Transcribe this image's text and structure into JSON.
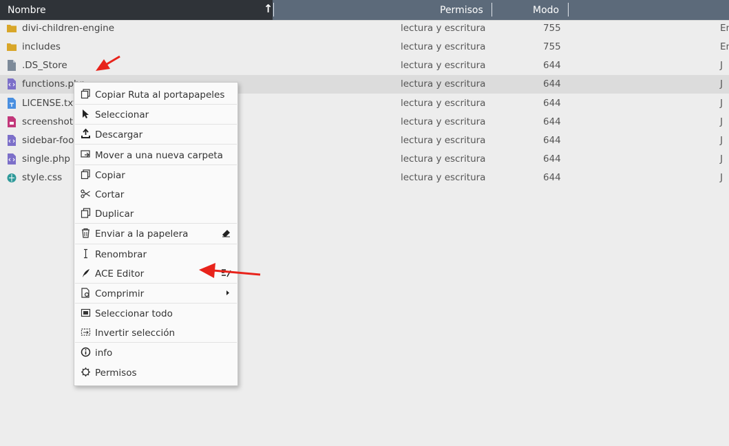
{
  "header": {
    "name_label": "Nombre",
    "permissions_label": "Permisos",
    "mode_label": "Modo",
    "sort_icon": "sort-arrow-up"
  },
  "files": [
    {
      "name": "divi-children-engine",
      "icon": "folder",
      "perm": "lectura y escritura",
      "mode": "755",
      "date": "En",
      "selected": false
    },
    {
      "name": "includes",
      "icon": "folder",
      "perm": "lectura y escritura",
      "mode": "755",
      "date": "En",
      "selected": false
    },
    {
      "name": ".DS_Store",
      "icon": "file-generic",
      "perm": "lectura y escritura",
      "mode": "644",
      "date": "J",
      "selected": false
    },
    {
      "name": "functions.php",
      "icon": "file-php",
      "perm": "lectura y escritura",
      "mode": "644",
      "date": "J",
      "selected": true
    },
    {
      "name": "LICENSE.txt",
      "icon": "file-text",
      "perm": "lectura y escritura",
      "mode": "644",
      "date": "J",
      "selected": false
    },
    {
      "name": "screenshot",
      "icon": "file-image",
      "perm": "lectura y escritura",
      "mode": "644",
      "date": "J",
      "selected": false
    },
    {
      "name": "sidebar-foo",
      "icon": "file-php",
      "perm": "lectura y escritura",
      "mode": "644",
      "date": "J",
      "selected": false
    },
    {
      "name": "single.php",
      "icon": "file-php",
      "perm": "lectura y escritura",
      "mode": "644",
      "date": "J",
      "selected": false
    },
    {
      "name": "style.css",
      "icon": "file-css",
      "perm": "lectura y escritura",
      "mode": "644",
      "date": "J",
      "selected": false
    }
  ],
  "context_menu": {
    "items": [
      {
        "label": "Copiar Ruta al portapapeles",
        "icon": "copy-icon"
      },
      {
        "label": "Seleccionar",
        "icon": "pointer-icon"
      },
      {
        "label": "Descargar",
        "icon": "download-icon"
      },
      {
        "label": "Mover a una nueva carpeta",
        "icon": "move-folder-icon"
      },
      {
        "label": "Copiar",
        "icon": "copy-icon"
      },
      {
        "label": "Cortar",
        "icon": "scissors-icon"
      },
      {
        "label": "Duplicar",
        "icon": "duplicate-icon"
      },
      {
        "label": "Enviar a la papelera",
        "icon": "trash-icon",
        "right_icon": "eraser-icon"
      },
      {
        "label": "Renombrar",
        "icon": "text-cursor-icon"
      },
      {
        "label": "ACE Editor",
        "icon": "quill-icon",
        "right_icon": "editor-icon"
      },
      {
        "label": "Comprimir",
        "icon": "archive-icon",
        "right_icon": "submenu-arrow-icon"
      },
      {
        "label": "Seleccionar todo",
        "icon": "select-all-icon"
      },
      {
        "label": "Invertir selección",
        "icon": "invert-selection-icon"
      },
      {
        "label": "info",
        "icon": "info-icon"
      },
      {
        "label": "Permisos",
        "icon": "gear-icon"
      }
    ]
  },
  "colors": {
    "header_bg": "#5c6a7a",
    "name_header_bg": "#2f3338",
    "folder": "#d8a629",
    "php_icon": "#7c6fc9",
    "annotation": "#e8231b"
  }
}
